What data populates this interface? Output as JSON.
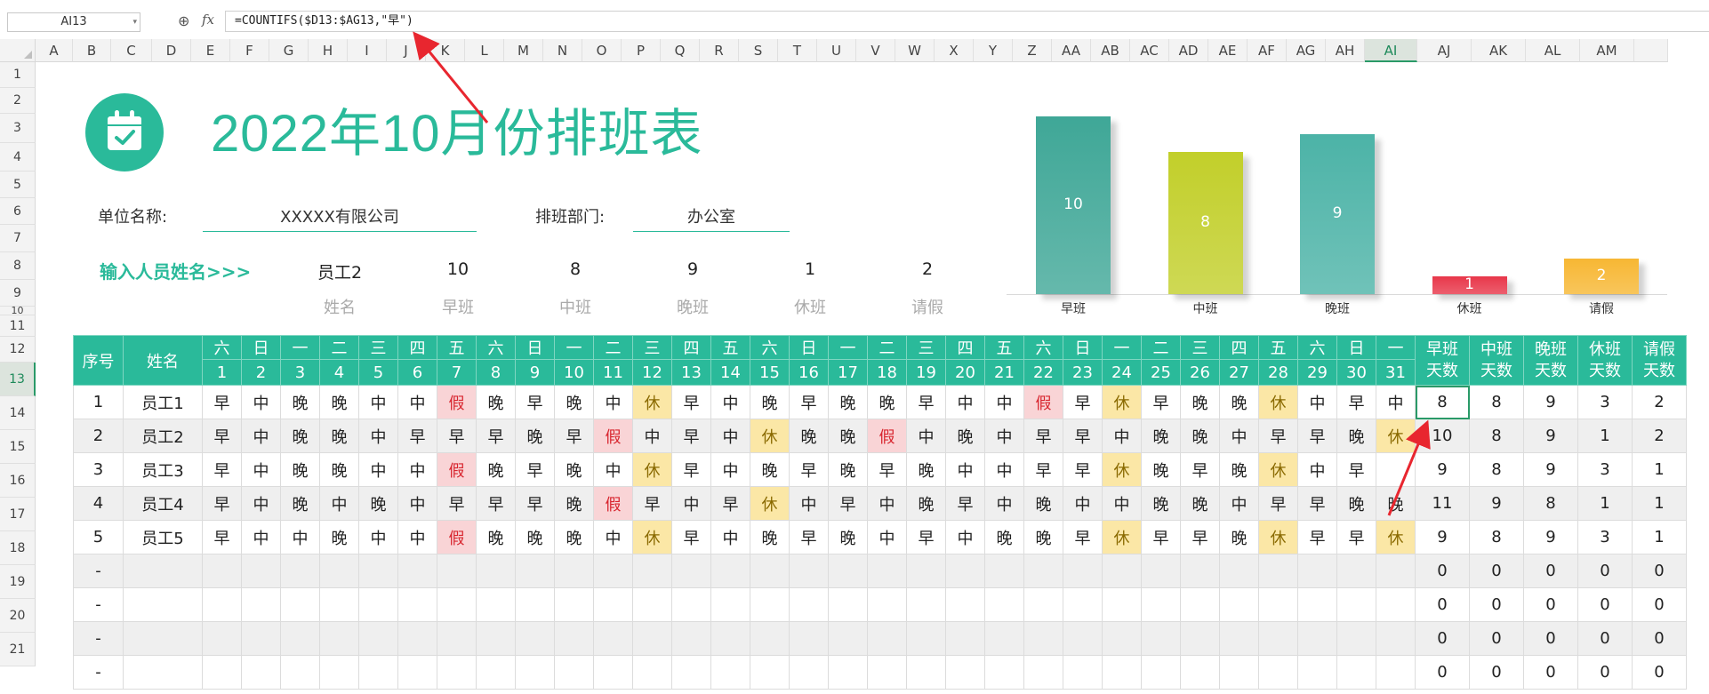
{
  "formula_bar": {
    "cell_ref": "AI13",
    "formula": "=COUNTIFS($D13:$AG13,\"早\")"
  },
  "columns": [
    "A",
    "B",
    "C",
    "D",
    "E",
    "F",
    "G",
    "H",
    "I",
    "J",
    "K",
    "L",
    "M",
    "N",
    "O",
    "P",
    "Q",
    "R",
    "S",
    "T",
    "U",
    "V",
    "W",
    "X",
    "Y",
    "Z",
    "AA",
    "AB",
    "AC",
    "AD",
    "AE",
    "AF",
    "AG",
    "AH",
    "AI",
    "AJ",
    "AK",
    "AL",
    "AM",
    ""
  ],
  "selected_column": "AI",
  "rows": [
    "1",
    "2",
    "3",
    "4",
    "5",
    "6",
    "7",
    "8",
    "9",
    "10",
    "11",
    "12",
    "13",
    "14",
    "15",
    "16",
    "17",
    "18",
    "19",
    "20",
    "21"
  ],
  "selected_row": "13",
  "title": "2022年10月份排班表",
  "unit_label": "单位名称:",
  "unit_value": "XXXXX有限公司",
  "dept_label": "排班部门:",
  "dept_value": "办公室",
  "input_label": "输入人员姓名>>>",
  "summary": {
    "values": [
      "员工2",
      "10",
      "8",
      "9",
      "1",
      "2"
    ],
    "labels": [
      "姓名",
      "早班",
      "中班",
      "晚班",
      "休班",
      "请假"
    ]
  },
  "chart_data": {
    "type": "bar",
    "categories": [
      "早班",
      "中班",
      "晚班",
      "休班",
      "请假"
    ],
    "values": [
      10,
      8,
      9,
      1,
      2
    ],
    "colors": [
      "#3fa797",
      "#c2cf2a",
      "#4cb3a7",
      "#e8374a",
      "#f7b733"
    ],
    "ylim": [
      0,
      10
    ],
    "grid": false
  },
  "table": {
    "hdr_seq": "序号",
    "hdr_name": "姓名",
    "weekdays": [
      "六",
      "日",
      "一",
      "二",
      "三",
      "四",
      "五",
      "六",
      "日",
      "一",
      "二",
      "三",
      "四",
      "五",
      "六",
      "日",
      "一",
      "二",
      "三",
      "四",
      "五",
      "六",
      "日",
      "一",
      "二",
      "三",
      "四",
      "五",
      "六",
      "日",
      "一"
    ],
    "days": [
      "1",
      "2",
      "3",
      "4",
      "5",
      "6",
      "7",
      "8",
      "9",
      "10",
      "11",
      "12",
      "13",
      "14",
      "15",
      "16",
      "17",
      "18",
      "19",
      "20",
      "21",
      "22",
      "23",
      "24",
      "25",
      "26",
      "27",
      "28",
      "29",
      "30",
      "31"
    ],
    "sum_headers": [
      [
        "早班",
        "天数"
      ],
      [
        "中班",
        "天数"
      ],
      [
        "晚班",
        "天数"
      ],
      [
        "休班",
        "天数"
      ],
      [
        "请假",
        "天数"
      ]
    ],
    "rows": [
      {
        "seq": "1",
        "name": "员工1",
        "shifts": [
          "早",
          "中",
          "晚",
          "晚",
          "中",
          "中",
          "假",
          "晚",
          "早",
          "晚",
          "中",
          "休",
          "早",
          "中",
          "晚",
          "早",
          "晚",
          "晚",
          "早",
          "中",
          "中",
          "假",
          "早",
          "休",
          "早",
          "晚",
          "晚",
          "休",
          "中",
          "早",
          "中"
        ],
        "sums": [
          "8",
          "8",
          "9",
          "3",
          "2"
        ]
      },
      {
        "seq": "2",
        "name": "员工2",
        "shifts": [
          "早",
          "中",
          "晚",
          "晚",
          "中",
          "早",
          "早",
          "早",
          "晚",
          "早",
          "假",
          "中",
          "早",
          "中",
          "休",
          "晚",
          "晚",
          "假",
          "中",
          "晚",
          "中",
          "早",
          "早",
          "中",
          "晚",
          "晚",
          "中",
          "早",
          "早",
          "晚",
          "休"
        ],
        "sums": [
          "10",
          "8",
          "9",
          "1",
          "2"
        ]
      },
      {
        "seq": "3",
        "name": "员工3",
        "shifts": [
          "早",
          "中",
          "晚",
          "晚",
          "中",
          "中",
          "假",
          "晚",
          "早",
          "晚",
          "中",
          "休",
          "早",
          "中",
          "晚",
          "早",
          "晚",
          "早",
          "晚",
          "中",
          "中",
          "早",
          "早",
          "休",
          "晚",
          "早",
          "晚",
          "休",
          "中",
          "早",
          ""
        ],
        "sums": [
          "9",
          "8",
          "9",
          "3",
          "1"
        ]
      },
      {
        "seq": "4",
        "name": "员工4",
        "shifts": [
          "早",
          "中",
          "晚",
          "中",
          "晚",
          "中",
          "早",
          "早",
          "早",
          "晚",
          "假",
          "早",
          "中",
          "早",
          "休",
          "中",
          "早",
          "中",
          "晚",
          "早",
          "中",
          "晚",
          "中",
          "中",
          "晚",
          "晚",
          "中",
          "早",
          "早",
          "晚",
          "晚"
        ],
        "sums": [
          "11",
          "9",
          "8",
          "1",
          "1"
        ]
      },
      {
        "seq": "5",
        "name": "员工5",
        "shifts": [
          "早",
          "中",
          "中",
          "晚",
          "中",
          "中",
          "假",
          "晚",
          "晚",
          "晚",
          "中",
          "休",
          "早",
          "中",
          "晚",
          "早",
          "晚",
          "中",
          "早",
          "中",
          "晚",
          "晚",
          "早",
          "休",
          "早",
          "早",
          "晚",
          "休",
          "早",
          "早",
          "休"
        ],
        "sums": [
          "9",
          "8",
          "9",
          "3",
          "1"
        ]
      },
      {
        "seq": "-",
        "name": "",
        "shifts": [],
        "sums": [
          "0",
          "0",
          "0",
          "0",
          "0"
        ]
      },
      {
        "seq": "-",
        "name": "",
        "shifts": [],
        "sums": [
          "0",
          "0",
          "0",
          "0",
          "0"
        ]
      },
      {
        "seq": "-",
        "name": "",
        "shifts": [],
        "sums": [
          "0",
          "0",
          "0",
          "0",
          "0"
        ]
      },
      {
        "seq": "-",
        "name": "",
        "shifts": [],
        "sums": [
          "0",
          "0",
          "0",
          "0",
          "0"
        ]
      }
    ]
  }
}
